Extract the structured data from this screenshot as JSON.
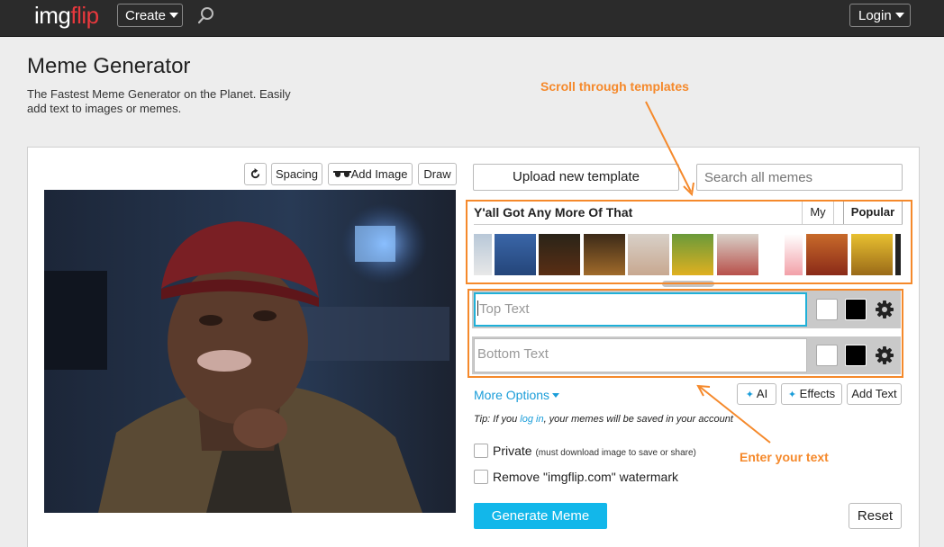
{
  "topbar": {
    "logo_img": "img",
    "logo_flip": "flip",
    "create_label": "Create",
    "login_label": "Login"
  },
  "page": {
    "title": "Meme Generator",
    "subtitle": "The Fastest Meme Generator on the Planet. Easily add text to images or memes."
  },
  "annotations": {
    "templates": "Scroll through templates",
    "text": "Enter your text",
    "color": "#f5892b"
  },
  "toolbar": {
    "spacing": "Spacing",
    "add_image": "Add Image",
    "draw": "Draw"
  },
  "templates": {
    "upload_label": "Upload new template",
    "search_placeholder": "Search all memes",
    "current_title": "Y'all Got Any More Of That",
    "tab_my": "My",
    "tab_popular": "Popular"
  },
  "text_boxes": {
    "top_placeholder": "Top Text",
    "bottom_placeholder": "Bottom Text"
  },
  "options": {
    "more_options": "More Options",
    "ai_label": "AI",
    "effects_label": "Effects",
    "add_text_label": "Add Text",
    "tip_prefix": "Tip: If you ",
    "tip_link": "log in",
    "tip_suffix": ", your memes will be saved in your account",
    "private_label": "Private",
    "private_note": "(must download image to save or share)",
    "watermark_label": "Remove \"imgflip.com\" watermark",
    "generate_label": "Generate Meme",
    "reset_label": "Reset"
  },
  "colors": {
    "accent": "#12b7ea",
    "link": "#1a9dd9",
    "annotation": "#f5892b",
    "topbar": "#2b2b2b",
    "logo_red": "#e8383d"
  }
}
